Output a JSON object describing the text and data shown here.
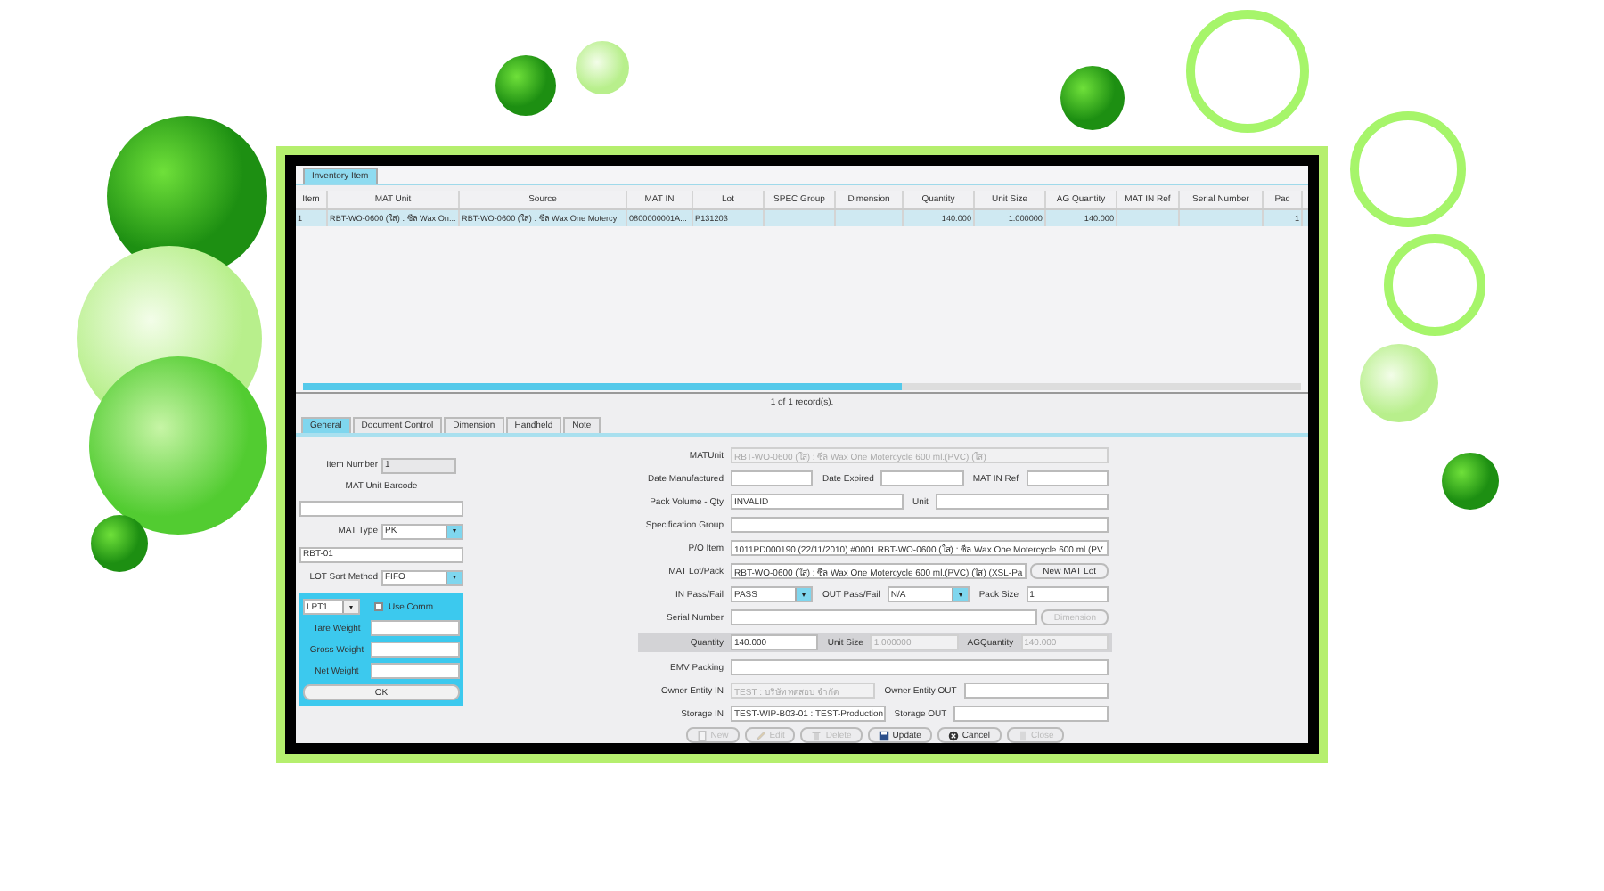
{
  "app_tab": {
    "label": "Inventory Item",
    "selected": true
  },
  "table": {
    "columns": [
      "Item",
      "MAT Unit",
      "Source",
      "MAT IN",
      "Lot",
      "SPEC Group",
      "Dimension",
      "Quantity",
      "Unit Size",
      "AG Quantity",
      "MAT IN Ref",
      "Serial Number",
      "Pac"
    ],
    "rows": [
      {
        "selected": true,
        "cells": [
          "1",
          "RBT-WO-0600 (ใส) : ซีล Wax On...",
          "RBT-WO-0600 (ใส) : ซีล Wax One Motercy",
          "0800000001A...",
          "P131203",
          "",
          "",
          "140.000",
          "1.000000",
          "140.000",
          "",
          "",
          "1"
        ]
      }
    ]
  },
  "record_count": "1 of 1 record(s).",
  "tabs": [
    {
      "label": "General",
      "selected": true
    },
    {
      "label": "Document Control",
      "selected": false
    },
    {
      "label": "Dimension",
      "selected": false
    },
    {
      "label": "Handheld",
      "selected": false
    },
    {
      "label": "Note",
      "selected": false
    }
  ],
  "left_panel": {
    "rows": [
      {
        "kind": "field",
        "label": "Item Number",
        "value": "1"
      },
      {
        "kind": "caption",
        "label": "MAT Unit Barcode"
      },
      {
        "kind": "field"
      },
      {
        "kind": "select",
        "label": "MAT Type",
        "value": "PK"
      },
      {
        "kind": "field",
        "value": "RBT-01"
      },
      {
        "kind": "select",
        "label": "LOT Sort Method",
        "value": "FIFO"
      }
    ],
    "scale_panel": {
      "port": "LPT1",
      "use_comm": {
        "label": "Use Comm",
        "checked": false
      },
      "weights": [
        {
          "label": "Tare Weight"
        },
        {
          "label": "Gross Weight"
        },
        {
          "label": "Net Weight"
        }
      ],
      "ok": "OK"
    }
  },
  "form": {
    "rows": [
      {
        "kind": "plain",
        "items": [
          {
            "kind": "field",
            "label": "MATUnit",
            "value": "RBT-WO-0600 (ใส) : ซีล Wax One Motercycle 600 ml.(PVC) (ใส)",
            "disabled": true
          }
        ]
      },
      {
        "kind": "plain",
        "items": [
          {
            "kind": "field",
            "label": "Date Manufactured",
            "disabled": false
          },
          {
            "kind": "field",
            "label": "Date Expired",
            "disabled": false
          },
          {
            "kind": "field",
            "label": "MAT IN Ref",
            "disabled": false
          }
        ]
      },
      {
        "kind": "plain",
        "items": [
          {
            "kind": "field",
            "label": "Pack Volume - Qty",
            "value": "INVALID",
            "disabled": false
          },
          {
            "kind": "field",
            "label": "Unit",
            "disabled": false
          }
        ]
      },
      {
        "kind": "plain",
        "items": [
          {
            "kind": "field",
            "label": "Specification Group",
            "disabled": false
          }
        ]
      },
      {
        "kind": "plain",
        "items": [
          {
            "kind": "field",
            "label": "P/O Item",
            "value": "1011PD000190 (22/11/2010) #0001 RBT-WO-0600 (ใส) : ซีล Wax One Motercycle 600 ml.(PV",
            "disabled": false
          }
        ]
      },
      {
        "kind": "plain",
        "items": [
          {
            "kind": "field",
            "label": "MAT Lot/Pack",
            "value": "RBT-WO-0600 (ใส) : ซีล Wax One Motercycle 600 ml.(PVC) (ใส) (XSL-Pa",
            "disabled": false
          },
          {
            "kind": "button",
            "label": "New MAT Lot",
            "disabled": false
          }
        ]
      },
      {
        "kind": "plain",
        "items": [
          {
            "kind": "select",
            "label": "IN Pass/Fail",
            "value": "PASS",
            "disabled": false
          },
          {
            "kind": "select",
            "label": "OUT Pass/Fail",
            "value": "N/A",
            "disabled": false
          },
          {
            "kind": "field",
            "label": "Pack Size",
            "value": "1",
            "disabled": false
          }
        ]
      },
      {
        "kind": "plain",
        "items": [
          {
            "kind": "field",
            "label": "Serial Number",
            "disabled": false
          },
          {
            "kind": "button",
            "label": "Dimension",
            "disabled": true
          }
        ]
      },
      {
        "kind": "band",
        "items": [
          {
            "kind": "field",
            "label": "Quantity",
            "value": "140.000",
            "disabled": false
          },
          {
            "kind": "field",
            "label": "Unit Size",
            "value": "1.000000",
            "disabled": true
          },
          {
            "kind": "field",
            "label": "AGQuantity",
            "value": "140.000",
            "disabled": true
          }
        ]
      },
      {
        "kind": "plain",
        "items": [
          {
            "kind": "field",
            "label": "EMV Packing",
            "disabled": false
          }
        ]
      },
      {
        "kind": "plain",
        "items": [
          {
            "kind": "field",
            "label": "Owner Entity IN",
            "value": "TEST : บริษัท ทดสอบ จำกัด",
            "disabled": true
          },
          {
            "kind": "field",
            "label": "Owner Entity OUT",
            "disabled": false
          }
        ]
      },
      {
        "kind": "plain",
        "items": [
          {
            "kind": "field",
            "label": "Storage IN",
            "value": "TEST-WIP-B03-01 : TEST-Production",
            "disabled": false
          },
          {
            "kind": "field",
            "label": "Storage OUT",
            "disabled": false
          }
        ]
      }
    ]
  },
  "actions": [
    {
      "kind": "new",
      "label": "New",
      "disabled": true
    },
    {
      "kind": "edit",
      "label": "Edit",
      "disabled": true
    },
    {
      "kind": "delete",
      "label": "Delete",
      "disabled": true
    },
    {
      "kind": "update",
      "label": "Update",
      "disabled": false
    },
    {
      "kind": "cancel",
      "label": "Cancel",
      "disabled": false
    },
    {
      "kind": "close",
      "label": "Close",
      "disabled": true
    }
  ]
}
